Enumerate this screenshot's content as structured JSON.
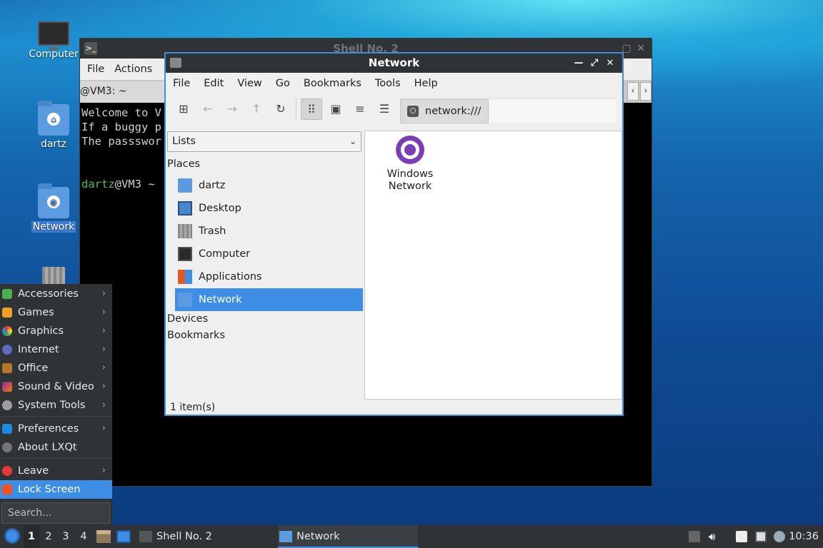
{
  "desktop": {
    "icons": [
      {
        "label": "Computer"
      },
      {
        "label": "dartz"
      },
      {
        "label": "Network"
      }
    ]
  },
  "terminal": {
    "title": "Shell No. 2",
    "menu": [
      "File",
      "Actions"
    ],
    "tab_label": "@VM3: ~",
    "lines": [
      "Welcome to V",
      "If a buggy p",
      "The passswor"
    ],
    "prompt_user": "dartz",
    "prompt_rest": "@VM3 ~"
  },
  "file_manager": {
    "title": "Network",
    "menu": [
      "File",
      "Edit",
      "View",
      "Go",
      "Bookmarks",
      "Tools",
      "Help"
    ],
    "path": "network:///",
    "side_select": "Lists",
    "places_heading": "Places",
    "places": [
      "dartz",
      "Desktop",
      "Trash",
      "Computer",
      "Applications",
      "Network"
    ],
    "devices_heading": "Devices",
    "bookmarks_heading": "Bookmarks",
    "content_item_line1": "Windows",
    "content_item_line2": "Network",
    "status": "1 item(s)"
  },
  "start_menu": {
    "items": [
      "Accessories",
      "Games",
      "Graphics",
      "Internet",
      "Office",
      "Sound & Video",
      "System Tools",
      "Preferences",
      "About LXQt",
      "Leave",
      "Lock Screen"
    ],
    "search_placeholder": "Search..."
  },
  "panel": {
    "workspaces": [
      "1",
      "2",
      "3",
      "4"
    ],
    "tasks": [
      "Shell No. 2",
      "Network"
    ],
    "clock": "10:36"
  },
  "colors": {
    "accent": "#3d8ee4",
    "panel": "#2f3336",
    "network_globe": "#7b3fb5"
  }
}
